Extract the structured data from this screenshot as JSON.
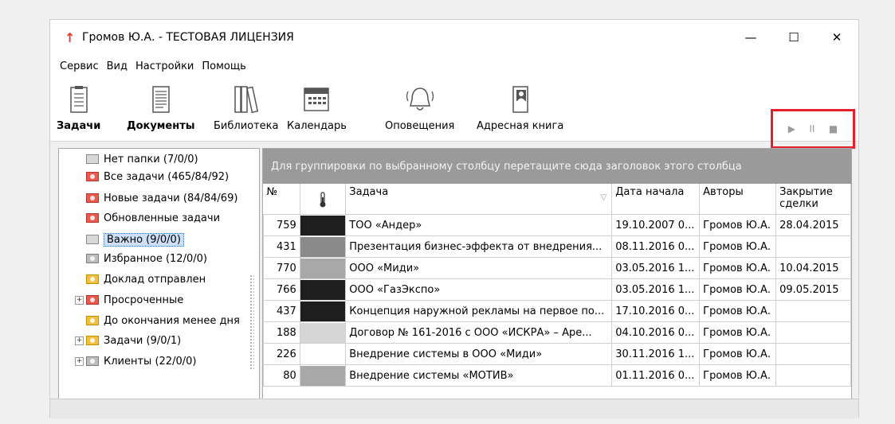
{
  "window": {
    "title": "Громов Ю.А. - ТЕСТОВАЯ ЛИЦЕНЗИЯ",
    "minimize": "—",
    "maximize": "☐",
    "close": "✕"
  },
  "menu": [
    "Сервис",
    "Вид",
    "Настройки",
    "Помощь"
  ],
  "toolbar": {
    "buttons": [
      {
        "label": "Задачи",
        "icon": "tasks-icon"
      },
      {
        "label": "Документы",
        "icon": "documents-icon"
      },
      {
        "label": "Библиотека",
        "icon": "library-icon"
      },
      {
        "label": "Календарь",
        "icon": "calendar-icon"
      },
      {
        "label": "Оповещения",
        "icon": "bell-icon"
      },
      {
        "label": "Адресная книга",
        "icon": "address-book-icon"
      }
    ],
    "player": {
      "play": "▶",
      "pause": "II",
      "stop": "■"
    }
  },
  "tree": [
    {
      "label": "Нет папки (7/0/0)",
      "color": "gray"
    },
    {
      "label": "Все задачи (465/84/92)",
      "color": "red"
    },
    {
      "label": "Новые задачи (84/84/69)",
      "color": "red"
    },
    {
      "label": "Обновленные задачи",
      "color": "red"
    },
    {
      "label": "Важно (9/0/0)",
      "color": "gray"
    },
    {
      "label": "Избранное (12/0/0)",
      "color": "grey2"
    },
    {
      "label": "Доклад отправлен",
      "color": "yellow"
    },
    {
      "label": "Просроченные",
      "color": "red",
      "expander": "+"
    },
    {
      "label": "До окончания менее дня",
      "color": "yellow"
    },
    {
      "label": "Задачи (9/0/1)",
      "color": "yellow",
      "expander": "+"
    },
    {
      "label": "Клиенты (22/0/0)",
      "color": "grey2",
      "expander": "+"
    }
  ],
  "grid": {
    "group_hint": "Для группировки по выбранному столбцу перетащите сюда заголовок этого столбца",
    "columns": [
      "№",
      "",
      "Задача",
      "Дата начала",
      "Авторы",
      "Закрытие сделки"
    ],
    "rows": [
      {
        "num": "759",
        "color": "#1e1e1e",
        "task": "ТОО «Андер»",
        "start": "19.10.2007 0...",
        "author": "Громов Ю.А.",
        "close": "28.04.2015"
      },
      {
        "num": "431",
        "color": "#8a8a8a",
        "task": "Презентация бизнес-эффекта от внедрения...",
        "start": "08.11.2016 0...",
        "author": "Громов Ю.А.",
        "close": ""
      },
      {
        "num": "770",
        "color": "#a8a8a8",
        "task": "ООО «Миди»",
        "start": "03.05.2016 1...",
        "author": "Громов Ю.А.",
        "close": "10.04.2015"
      },
      {
        "num": "766",
        "color": "#1e1e1e",
        "task": "ООО «ГазЭкспо»",
        "start": "03.05.2016 1...",
        "author": "Громов Ю.А.",
        "close": "09.05.2015"
      },
      {
        "num": "437",
        "color": "#1e1e1e",
        "task": "Концепция наружной рекламы на первое по...",
        "start": "17.10.2016 0...",
        "author": "Громов Ю.А.",
        "close": ""
      },
      {
        "num": "188",
        "color": "#d6d6d6",
        "task": "Договор № 161-2016 с ООО «ИСКРА» – Аре...",
        "start": "04.10.2016 0...",
        "author": "Громов Ю.А.",
        "close": ""
      },
      {
        "num": "226",
        "color": "#ffffff",
        "task": "Внедрение системы в ООО «Миди»",
        "start": "30.11.2016 1...",
        "author": "Громов Ю.А.",
        "close": ""
      },
      {
        "num": "80",
        "color": "#a8a8a8",
        "task": "Внедрение системы «МОТИВ»",
        "start": "01.11.2016 0...",
        "author": "Громов Ю.А.",
        "close": ""
      }
    ]
  },
  "colors": {
    "accent_red": "#e3202c",
    "title_arrow": "#e23b2e"
  }
}
